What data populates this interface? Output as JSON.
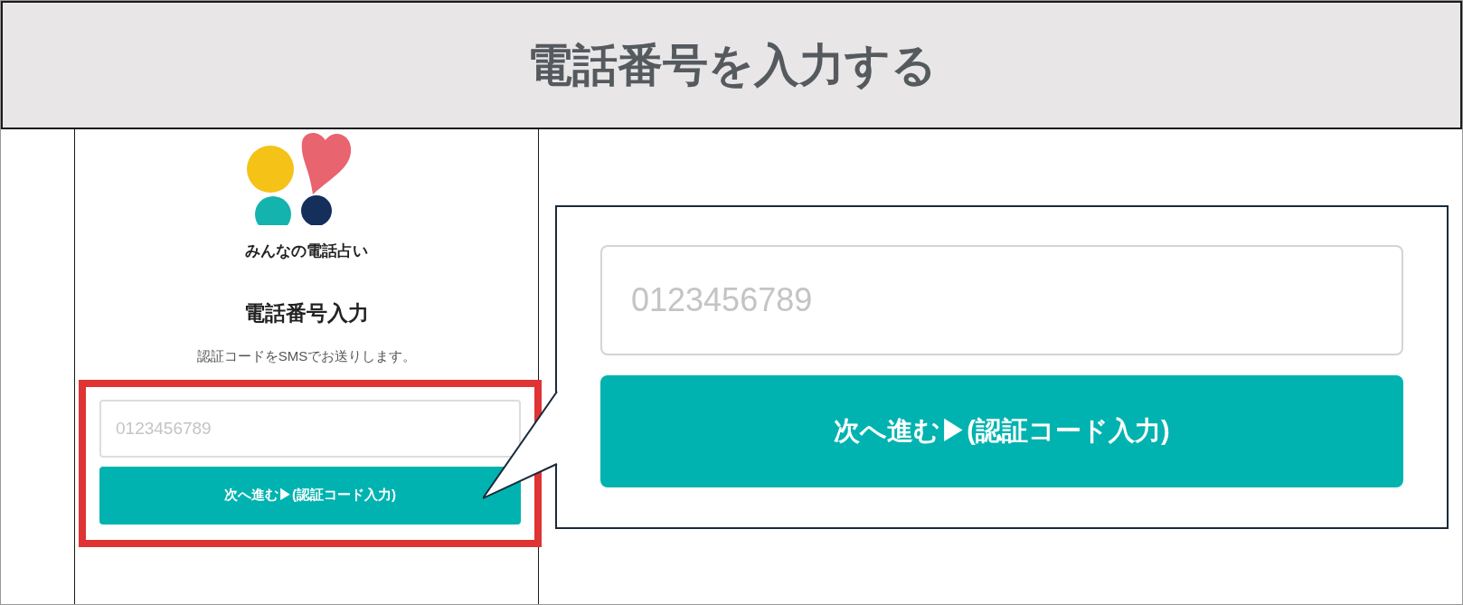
{
  "banner": {
    "title": "電話番号を入力する"
  },
  "phone": {
    "app_name": "みんなの電話占い",
    "heading": "電話番号入力",
    "description": "認証コードをSMSでお送りします。",
    "phone_field": {
      "placeholder": "0123456789"
    },
    "next_button": "次へ進む▶(認証コード入力)"
  },
  "zoom_callout": {
    "phone_field": {
      "placeholder": "0123456789"
    },
    "next_button": "次へ進む▶(認証コード入力)"
  }
}
